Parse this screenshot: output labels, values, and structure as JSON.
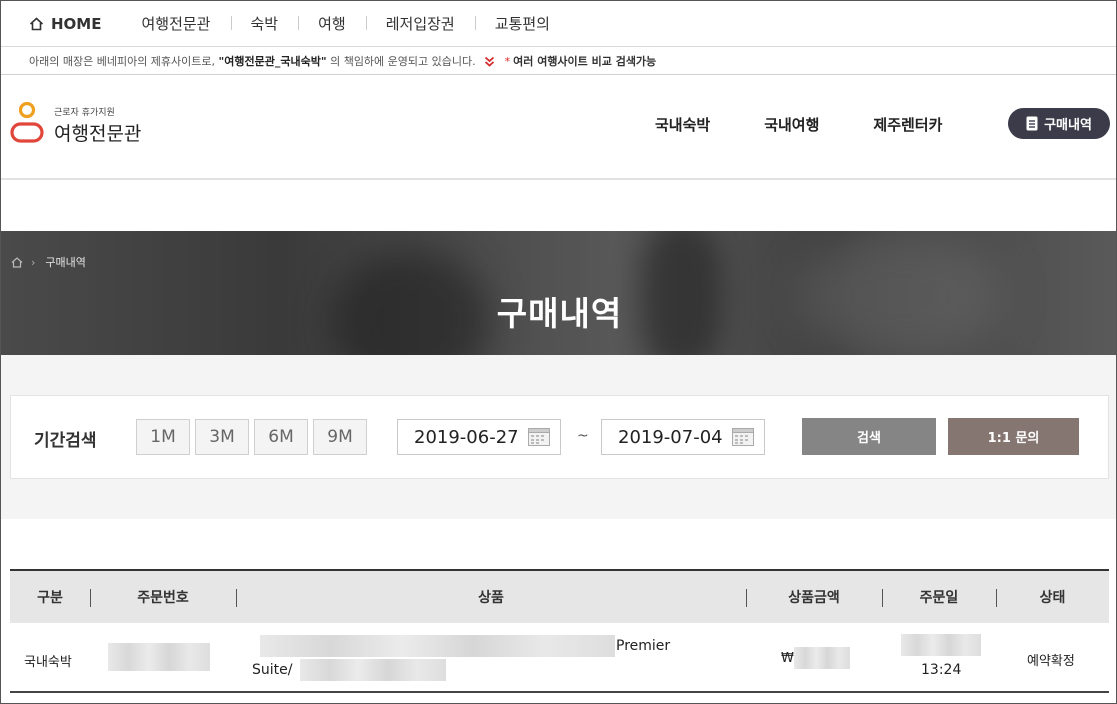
{
  "topnav": {
    "home": "HOME",
    "items": [
      "여행전문관",
      "숙박",
      "여행",
      "레저입장권",
      "교통편의"
    ]
  },
  "notice": {
    "prefix": "아래의 매장은 베네피아의 제휴사이트로,",
    "site": "\"여행전문관_국내숙박\"",
    "suffix": "의 책임하에 운영되고 있습니다.",
    "star": "*",
    "compare": "여러 여행사이트 비교 검색가능"
  },
  "header": {
    "logo_sub": "근로자 휴가지원",
    "logo_main": "여행전문관",
    "gnb": [
      "국내숙박",
      "국내여행",
      "제주렌터카"
    ],
    "purchase_button": "구매내역"
  },
  "banner": {
    "breadcrumb": "구매내역",
    "title": "구매내역"
  },
  "search": {
    "label": "기간검색",
    "periods": [
      "1M",
      "3M",
      "6M",
      "9M"
    ],
    "start_date": "2019-06-27",
    "end_date": "2019-07-04",
    "tilde": "~",
    "search_button": "검색",
    "inquiry_button": "1:1 문의"
  },
  "table": {
    "headers": [
      "구분",
      "주문번호",
      "상품",
      "상품금액",
      "주문일",
      "상태"
    ],
    "rows": [
      {
        "category": "국내숙박",
        "product_line1": "Premier",
        "product_line2": "Suite/",
        "currency": "₩",
        "time": "13:24",
        "status": "예약확정"
      }
    ]
  },
  "colors": {
    "purchase_button_bg": "#3b3b4a",
    "search_button_bg": "#858585",
    "inquiry_button_bg": "#857672",
    "notice_star": "#d62b2b",
    "logo_orange": "#f0a020",
    "logo_red": "#e0463a"
  }
}
